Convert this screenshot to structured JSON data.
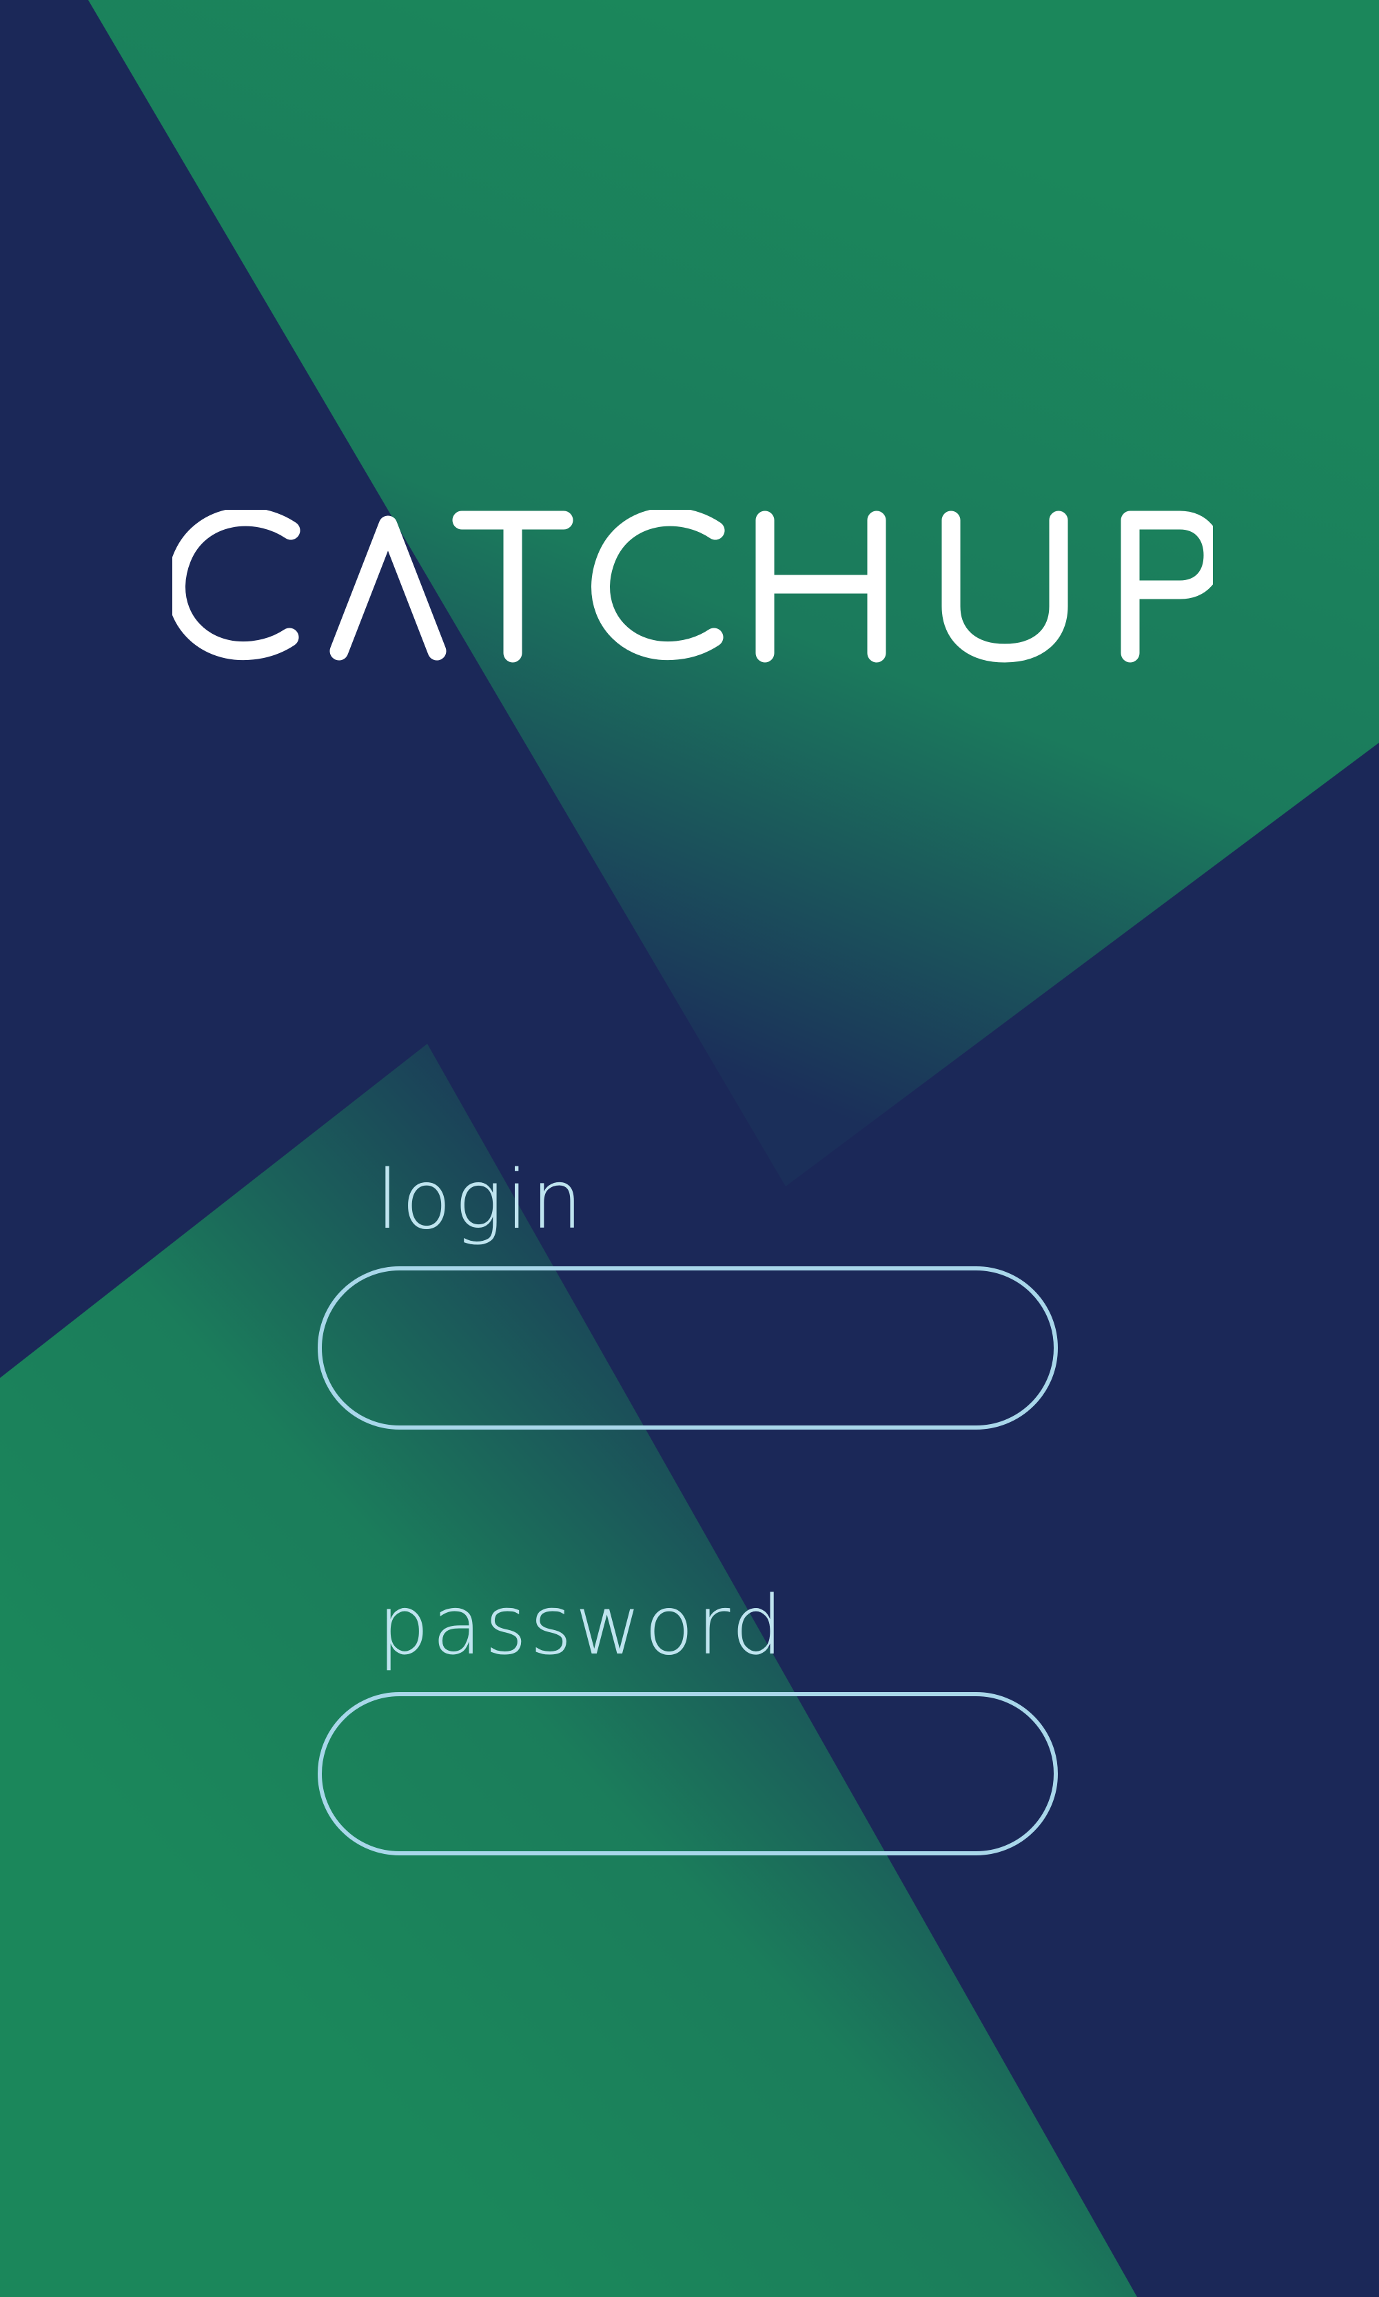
{
  "app": {
    "brand": "CATCHUP"
  },
  "login_form": {
    "login_label": "login",
    "login_value": "",
    "password_label": "password",
    "password_value": ""
  },
  "colors": {
    "navy": "#1b2858",
    "green": "#1b875b",
    "field_border": "#a9d7ea",
    "label_text": "#bfe4ef",
    "logo": "#ffffff"
  }
}
